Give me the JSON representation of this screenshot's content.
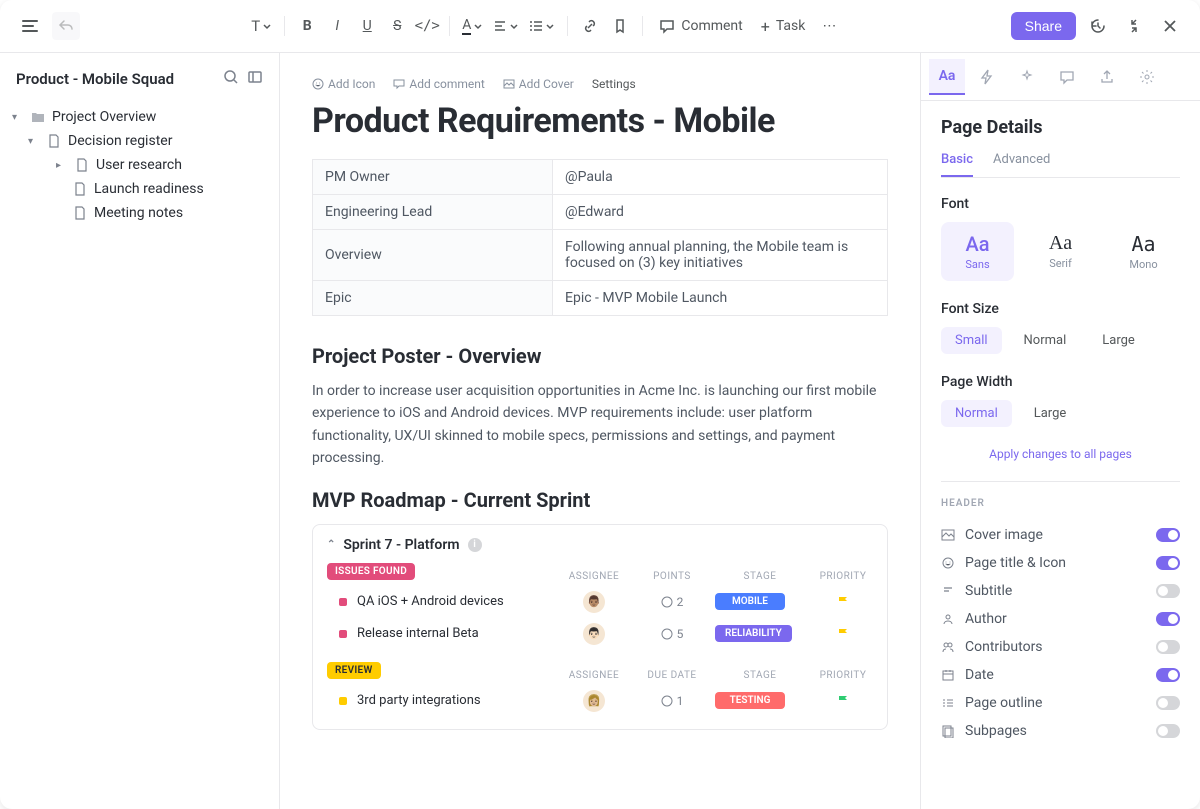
{
  "toolbar": {
    "comment": "Comment",
    "task": "Task",
    "share": "Share"
  },
  "sidebar": {
    "title": "Product - Mobile Squad",
    "tree": {
      "overview": "Project Overview",
      "decision": "Decision register",
      "research": "User research",
      "launch": "Launch readiness",
      "meeting": "Meeting notes"
    }
  },
  "page": {
    "actions": {
      "add_icon": "Add Icon",
      "add_comment": "Add comment",
      "add_cover": "Add Cover",
      "settings": "Settings"
    },
    "title": "Product Requirements - Mobile",
    "meta": {
      "rows": [
        {
          "label": "PM Owner",
          "value": "@Paula"
        },
        {
          "label": "Engineering Lead",
          "value": "@Edward"
        },
        {
          "label": "Overview",
          "value": "Following annual planning, the Mobile team is focused on (3) key initiatives"
        },
        {
          "label": "Epic",
          "value": "Epic - MVP Mobile Launch"
        }
      ]
    },
    "section1": {
      "heading": "Project Poster - Overview",
      "body": "In order to increase user acquisition opportunities in Acme Inc. is launching our first mobile experience to iOS and Android devices. MVP requirements include: user platform functionality, UX/UI skinned to mobile specs, permissions and settings, and payment processing."
    },
    "section2": {
      "heading": "MVP Roadmap - Current Sprint",
      "sprint_title": "Sprint  7 - Platform",
      "group1": {
        "chip": "ISSUES FOUND",
        "cols": {
          "c1": "ASSIGNEE",
          "c2": "POINTS",
          "c3": "STAGE",
          "c4": "PRIORITY"
        },
        "tasks": [
          {
            "name": "QA iOS + Android devices",
            "dot": "#e24c7b",
            "points": "2",
            "stage": "MOBILE",
            "stage_color": "#4a7dff"
          },
          {
            "name": "Release internal Beta",
            "dot": "#e24c7b",
            "points": "5",
            "stage": "RELIABILITY",
            "stage_color": "#7b68ee"
          }
        ]
      },
      "group2": {
        "chip": "REVIEW",
        "cols": {
          "c1": "ASSIGNEE",
          "c2": "DUE DATE",
          "c3": "STAGE",
          "c4": "PRIORITY"
        },
        "tasks": [
          {
            "name": "3rd party integrations",
            "dot": "#ffcc00",
            "points": "1",
            "stage": "TESTING",
            "stage_color": "#ff6b6b"
          }
        ]
      }
    }
  },
  "panel": {
    "title": "Page Details",
    "subtabs": {
      "basic": "Basic",
      "advanced": "Advanced"
    },
    "font": {
      "label": "Font",
      "sans": "Sans",
      "serif": "Serif",
      "mono": "Mono"
    },
    "font_size": {
      "label": "Font Size",
      "small": "Small",
      "normal": "Normal",
      "large": "Large"
    },
    "page_width": {
      "label": "Page Width",
      "normal": "Normal",
      "large": "Large"
    },
    "apply": "Apply changes to all pages",
    "header_section": "HEADER",
    "toggles": [
      {
        "label": "Cover image",
        "on": true
      },
      {
        "label": "Page title & Icon",
        "on": true
      },
      {
        "label": "Subtitle",
        "on": false
      },
      {
        "label": "Author",
        "on": true
      },
      {
        "label": "Contributors",
        "on": false
      },
      {
        "label": "Date",
        "on": true
      },
      {
        "label": "Page outline",
        "on": false
      },
      {
        "label": "Subpages",
        "on": false
      }
    ]
  }
}
